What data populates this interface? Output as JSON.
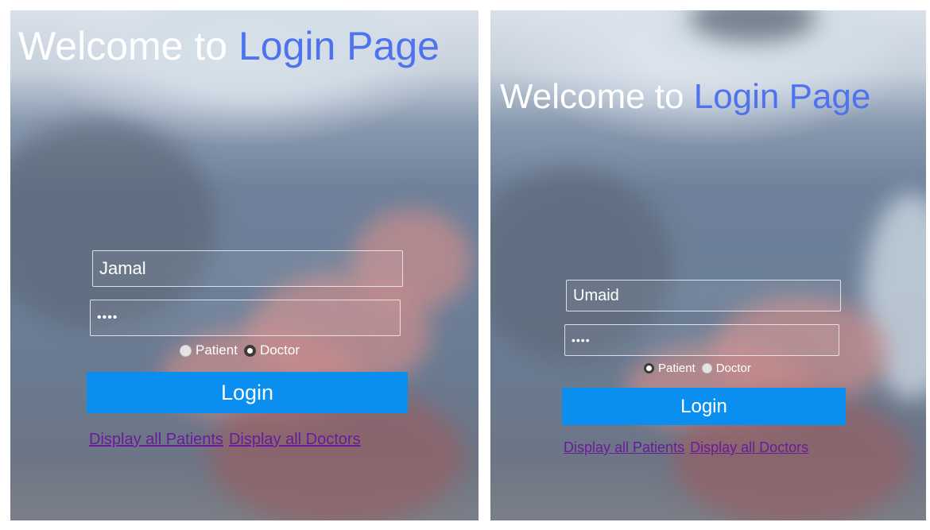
{
  "screens": [
    {
      "title_prefix": "Welcome to ",
      "title_accent": "Login Page",
      "username_value": "Jamal",
      "password_value": "••••",
      "radio_patient_label": "Patient",
      "radio_doctor_label": "Doctor",
      "selected_role": "Doctor",
      "login_label": "Login",
      "link_patients": "Display all Patients",
      "link_doctors": "Display all Doctors"
    },
    {
      "title_prefix": "Welcome to ",
      "title_accent": "Login Page",
      "username_value": "Umaid",
      "password_value": "••••",
      "radio_patient_label": "Patient",
      "radio_doctor_label": "Doctor",
      "selected_role": "Patient",
      "login_label": "Login",
      "link_patients": "Display all Patients",
      "link_doctors": "Display all Doctors"
    }
  ],
  "colors": {
    "accent": "#4f72ee",
    "button": "#0a8ff0",
    "link": "#6a1b9a"
  }
}
